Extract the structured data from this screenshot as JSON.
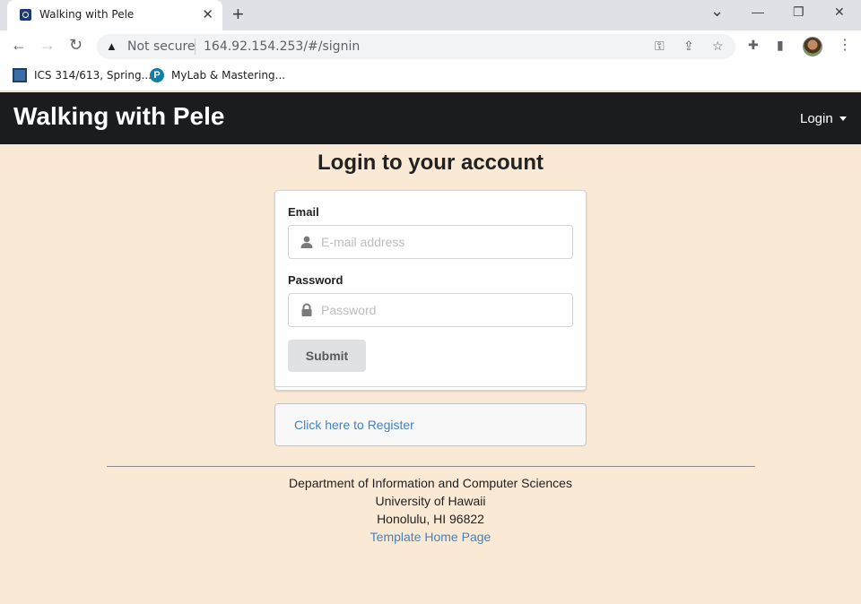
{
  "browser": {
    "tab_title": "Walking with Pele",
    "tab_close": "✕",
    "new_tab": "+",
    "win_min": "—",
    "win_restore": "❐",
    "win_close": "✕",
    "chevron": "⌄",
    "security_label": "Not secure",
    "url": "164.92.154.253/#/signin",
    "bookmarks": [
      {
        "label": "ICS 314/613, Spring..."
      },
      {
        "label": "MyLab & Mastering..."
      }
    ],
    "icons": {
      "back": "←",
      "forward": "→",
      "reload": "↻",
      "warning": "▲",
      "key": "⚿",
      "share": "⇪",
      "star": "☆",
      "puzzle": "✚",
      "sidepanel": "▮",
      "menu": "⋮"
    }
  },
  "site": {
    "brand": "Walking with Pele",
    "login_menu": "Login"
  },
  "main": {
    "title": "Login to your account",
    "email_label": "Email",
    "email_placeholder": "E-mail address",
    "password_label": "Password",
    "password_placeholder": "Password",
    "submit_label": "Submit",
    "register_link": "Click here to Register"
  },
  "footer": {
    "line1": "Department of Information and Computer Sciences",
    "line2": "University of Hawaii",
    "line3": "Honolulu, HI 96822",
    "link": "Template Home Page"
  },
  "colors": {
    "page_bg": "#fae9d5",
    "navbar_bg": "#1b1c1d",
    "link": "#4183c4"
  }
}
